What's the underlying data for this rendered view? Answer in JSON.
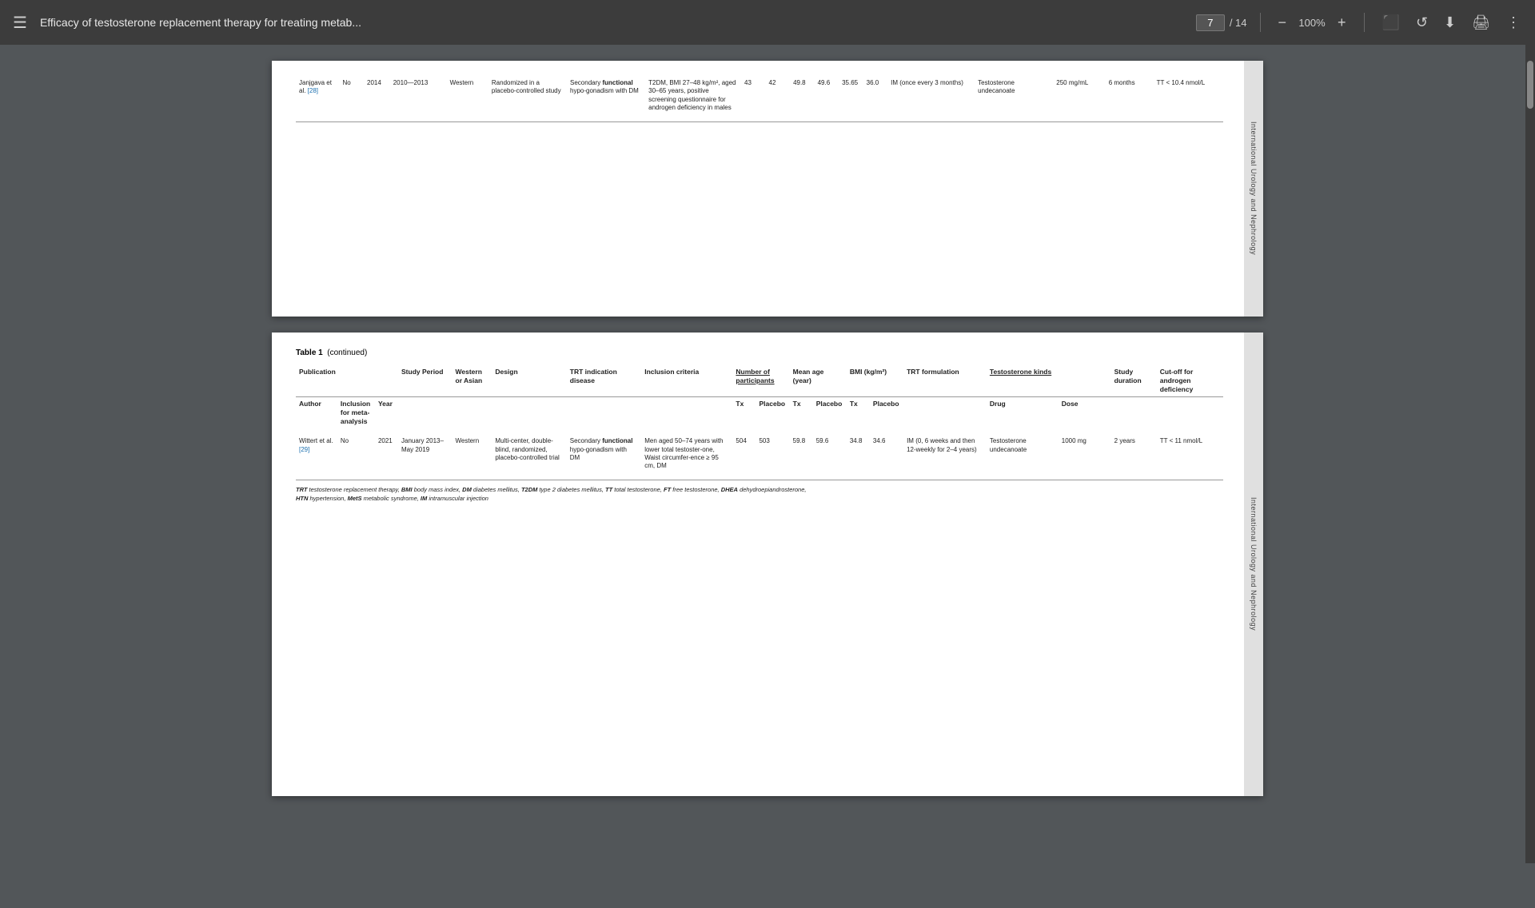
{
  "topbar": {
    "menu_label": "☰",
    "title": "Efficacy of testosterone replacement therapy for treating metab...",
    "page_current": "7",
    "page_separator": "/",
    "page_total": "14",
    "zoom_value": "100%",
    "zoom_decrease": "−",
    "zoom_increase": "+",
    "icon_fullscreen": "⬜",
    "icon_refresh": "↺",
    "icon_download": "⬇",
    "icon_print": "🖨",
    "icon_more": "⋮"
  },
  "side_label_text": "International Urology and Nephrology",
  "page1": {
    "table_rows": [
      {
        "author": "Janjgava et al. [28]",
        "inclusion": "No",
        "year": "2014",
        "period": "2010—2013",
        "western_asian": "Western",
        "design": "Randomized in a placebo-controlled study",
        "trt_indication": "Secondary functional hypo-gonadism with DM",
        "inclusion_criteria": "T2DM, BMI 27–48 kg/m², aged 30–65 years, positive screening questionnaire for androgen deficiency in males",
        "tx_n": "43",
        "placebo_n": "42",
        "tx_mean_age": "49.8",
        "placebo_mean_age": "49.6",
        "tx_bmi": "35.65",
        "placebo_bmi": "36.0",
        "trt_formulation": "IM (once every 3 months)",
        "drug": "Testosterone undecanoate",
        "dose": "250 mg/mL",
        "study_duration": "6 months",
        "cutoff": "TT < 10.4 nmol/L"
      }
    ]
  },
  "page2": {
    "table_title": "Table 1",
    "table_continued": "(continued)",
    "columns": {
      "publication": "Publication",
      "study_period": "Study Period",
      "western_asian": "Western or Asian",
      "design": "Design",
      "trt_indication": "TRT indication disease",
      "inclusion_criteria": "Inclusion criteria",
      "number_participants": "Number of participants",
      "mean_age": "Mean age (year)",
      "bmi": "BMI (kg/m²)",
      "trt_formulation": "TRT formulation",
      "testosterone_kinds": "Testosterone kinds",
      "study_duration": "Study duration",
      "cutoff": "Cut-off for androgen deficiency"
    },
    "subcolumns": {
      "author": "Author",
      "inclusion": "Inclusion for meta-analysis",
      "year": "Year",
      "tx": "Tx",
      "placebo": "Placebo",
      "drug": "Drug",
      "dose": "Dose"
    },
    "rows": [
      {
        "author": "Wittert et al. [29]",
        "inclusion": "No",
        "year": "2021",
        "period": "January 2013–May 2019",
        "western_asian": "Western",
        "design": "Multi-center, double-blind, randomized, placebo-controlled trial",
        "trt_indication": "Secondary functional hypo-gonadism with DM",
        "inclusion_criteria": "Men aged 50–74 years with lower total testoster-one, Waist circumference ≥ 95 cm, DM",
        "tx_n": "504",
        "placebo_n": "503",
        "tx_mean_age": "59.8",
        "placebo_mean_age": "59.6",
        "tx_bmi": "34.8",
        "placebo_bmi": "34.6",
        "trt_formulation": "IM (0, 6 weeks and then 12-weekly for 2–4 years)",
        "drug": "Testosterone undecanoate",
        "dose": "1000 mg",
        "study_duration": "2 years",
        "cutoff": "TT < 11 nmol/L"
      }
    ],
    "footnote_line1": "TRT testosterone replacement therapy, BMI body mass index, DM diabetes mellitus, T2DM type 2 diabetes mellitus, TT total testosterone, FT free testosterone, DHEA dehydroepiandrosterone,",
    "footnote_line2": "HTN hypertension, MetS metabolic syndrome, IM intramuscular injection"
  }
}
